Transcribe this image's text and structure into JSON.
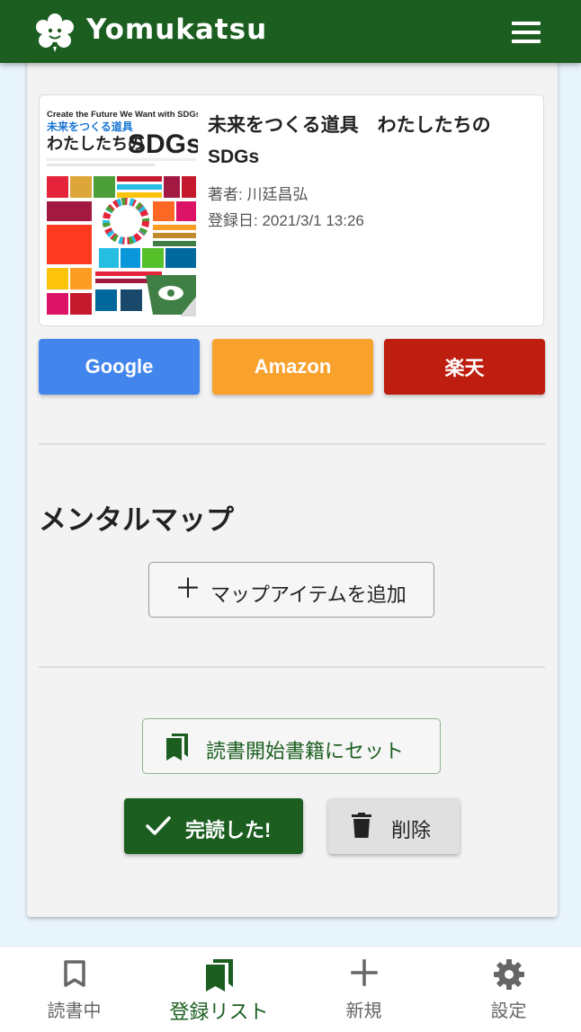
{
  "app": {
    "title": "Yomukatsu",
    "colors": {
      "header": "#1b5e20",
      "accent": "#1b5e20",
      "google": "#4185ed",
      "amazon": "#f9a12d",
      "rakuten": "#bd1e0f"
    }
  },
  "header": {
    "logo_icon": "flower-logo-icon",
    "menu_icon": "hamburger-menu-icon"
  },
  "book": {
    "title": "未来をつくる道具　わたしたちのSDGs",
    "author_label": "著者: 川廷昌弘",
    "registered_label": "登録日: 2021/3/1 13:26",
    "cover": {
      "line1": "Create the Future We Want with SDGs",
      "line2": "未来をつくる道具",
      "line3": "わたしたちの",
      "line4": "SDGs"
    }
  },
  "shop_buttons": {
    "google": "Google",
    "amazon": "Amazon",
    "rakuten": "楽天"
  },
  "mental_map": {
    "heading": "メンタルマップ",
    "add_button": "マップアイテムを追加",
    "add_icon": "plus-icon"
  },
  "actions": {
    "set_reading": "読書開始書籍にセット",
    "set_reading_icon": "bookmarks-icon",
    "done": "完読した!",
    "done_icon": "check-icon",
    "delete": "削除",
    "delete_icon": "trash-icon"
  },
  "bottom_nav": {
    "items": [
      {
        "label": "読書中",
        "icon": "bookmark-outline-icon",
        "active": false
      },
      {
        "label": "登録リスト",
        "icon": "bookmarks-icon",
        "active": true
      },
      {
        "label": "新規",
        "icon": "plus-icon",
        "active": false
      },
      {
        "label": "設定",
        "icon": "gear-icon",
        "active": false
      }
    ]
  }
}
